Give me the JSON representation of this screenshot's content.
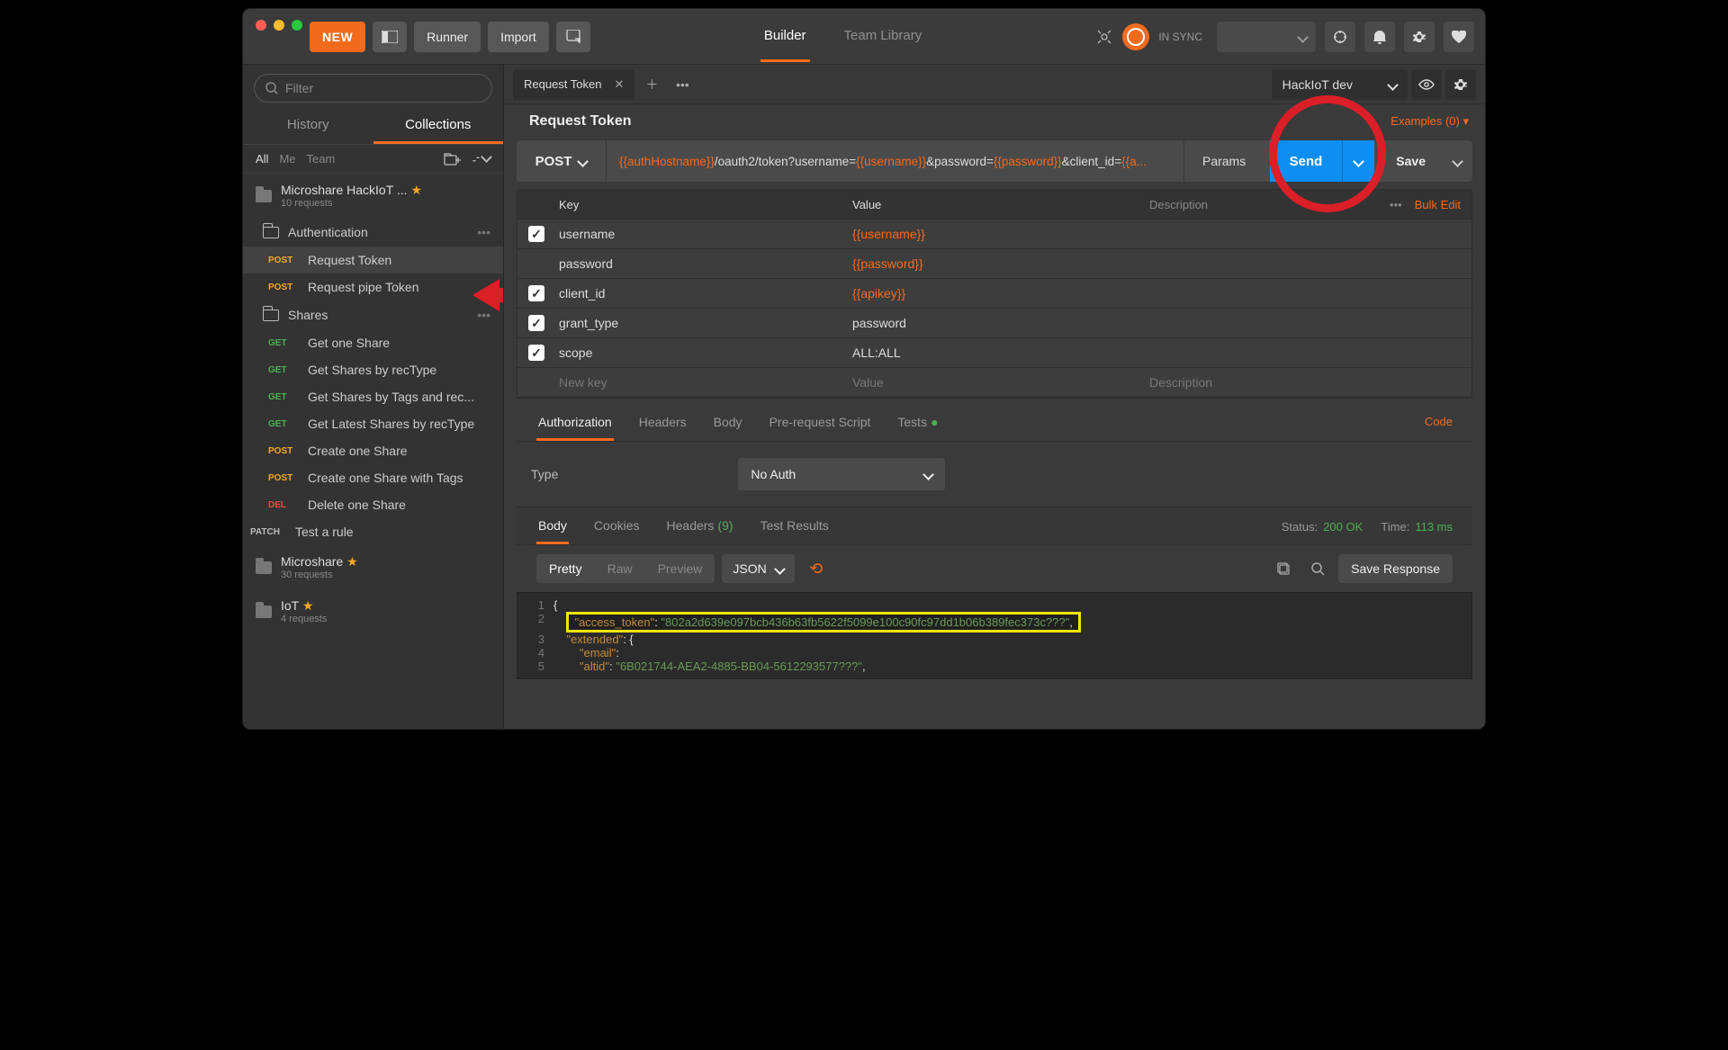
{
  "toolbar": {
    "new": "NEW",
    "runner": "Runner",
    "import": "Import",
    "tab_builder": "Builder",
    "tab_team": "Team Library",
    "sync": "IN SYNC"
  },
  "sidebar": {
    "filter_placeholder": "Filter",
    "tab_history": "History",
    "tab_collections": "Collections",
    "scope_all": "All",
    "scope_me": "Me",
    "scope_team": "Team",
    "collections": [
      {
        "name": "Microshare HackIoT ...",
        "sub": "10 requests",
        "star": true,
        "folders": [
          {
            "name": "Authentication",
            "requests": [
              {
                "method": "POST",
                "name": "Request Token",
                "active": true
              },
              {
                "method": "POST",
                "name": "Request pipe Token"
              }
            ]
          },
          {
            "name": "Shares",
            "requests": [
              {
                "method": "GET",
                "name": "Get one Share"
              },
              {
                "method": "GET",
                "name": "Get Shares by recType"
              },
              {
                "method": "GET",
                "name": "Get Shares by Tags and rec..."
              },
              {
                "method": "GET",
                "name": "Get Latest Shares by recType"
              },
              {
                "method": "POST",
                "name": "Create one Share"
              },
              {
                "method": "POST",
                "name": "Create one Share with Tags"
              },
              {
                "method": "DEL",
                "name": "Delete one Share"
              }
            ]
          }
        ],
        "loose": [
          {
            "method": "PATCH",
            "name": "Test a rule"
          }
        ]
      },
      {
        "name": "Microshare",
        "sub": "30 requests",
        "star": true
      },
      {
        "name": "IoT",
        "sub": "4 requests",
        "star": true
      }
    ]
  },
  "request": {
    "tab_title": "Request Token",
    "title": "Request Token",
    "examples": "Examples (0)",
    "env": "HackIoT dev",
    "method": "POST",
    "url_parts": [
      {
        "v": "{{authHostname}}",
        "t": "var"
      },
      {
        "v": "/oauth2/token?username=",
        "t": "txt"
      },
      {
        "v": "{{username}}",
        "t": "var"
      },
      {
        "v": "&password=",
        "t": "txt"
      },
      {
        "v": "{{password}}",
        "t": "var"
      },
      {
        "v": "&client_id=",
        "t": "txt"
      },
      {
        "v": "{{a...",
        "t": "var"
      }
    ],
    "params_label": "Params",
    "send": "Send",
    "save": "Save",
    "headers": {
      "key": "Key",
      "value": "Value",
      "desc": "Description",
      "bulk": "Bulk Edit"
    },
    "params": [
      {
        "on": true,
        "key": "username",
        "value": "{{username}}",
        "plain": false
      },
      {
        "on": false,
        "key": "password",
        "value": "{{password}}",
        "plain": false
      },
      {
        "on": true,
        "key": "client_id",
        "value": "{{apikey}}",
        "plain": false
      },
      {
        "on": true,
        "key": "grant_type",
        "value": "password",
        "plain": true
      },
      {
        "on": true,
        "key": "scope",
        "value": "ALL:ALL",
        "plain": true
      }
    ],
    "new_row": {
      "key": "New key",
      "value": "Value",
      "desc": "Description"
    },
    "midTabs": {
      "auth": "Authorization",
      "headers": "Headers",
      "body": "Body",
      "prereq": "Pre-request Script",
      "tests": "Tests"
    },
    "code_link": "Code",
    "auth": {
      "type_label": "Type",
      "selected": "No Auth"
    }
  },
  "response": {
    "tabs": {
      "body": "Body",
      "cookies": "Cookies",
      "headers": "Headers",
      "headers_count": "(9)",
      "tests": "Test Results"
    },
    "status_label": "Status:",
    "status": "200 OK",
    "time_label": "Time:",
    "time": "113 ms",
    "views": {
      "pretty": "Pretty",
      "raw": "Raw",
      "preview": "Preview"
    },
    "fmt": "JSON",
    "save_response": "Save Response",
    "lines": [
      "{",
      "    \"access_token\": \"802a2d639e097bcb436b63fb5622f5099e100c90fc97dd1b06b389fec373c???\",",
      "    \"extended\": {",
      "        \"email\":",
      "        \"altid\": \"6B021744-AEA2-4885-BB04-5612293577???\","
    ]
  }
}
